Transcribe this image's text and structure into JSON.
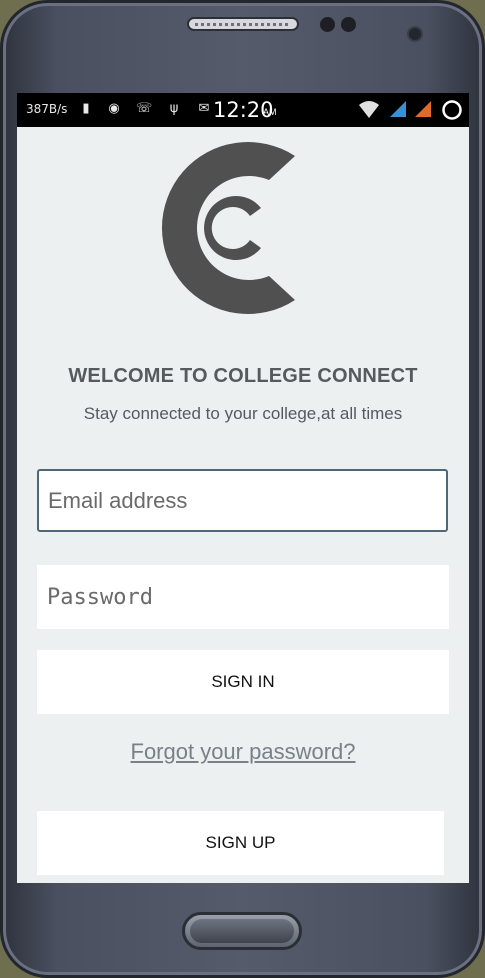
{
  "status_bar": {
    "network_speed": "387B/s",
    "time": "12:20",
    "ampm": "AM",
    "icons": [
      "notification-icon",
      "app-icon",
      "whatsapp-icon",
      "usb-icon",
      "gmail-icon",
      "download-icon",
      "wifi-icon",
      "signal-blue-icon",
      "signal-orange-icon",
      "circle-icon"
    ]
  },
  "logo": {
    "name": "college-connect-logo",
    "color": "#505050"
  },
  "welcome": {
    "title": "WELCOME TO COLLEGE CONNECT",
    "subtitle": "Stay connected to your college,at all times"
  },
  "form": {
    "email_placeholder": "Email address",
    "password_placeholder": "Password",
    "sign_in_label": "SIGN IN",
    "forgot_label": "Forgot your password?",
    "sign_up_label": "SIGN UP"
  },
  "colors": {
    "background": "#ecf0f1",
    "text": "#555a5e",
    "email_border": "#4e6878"
  }
}
